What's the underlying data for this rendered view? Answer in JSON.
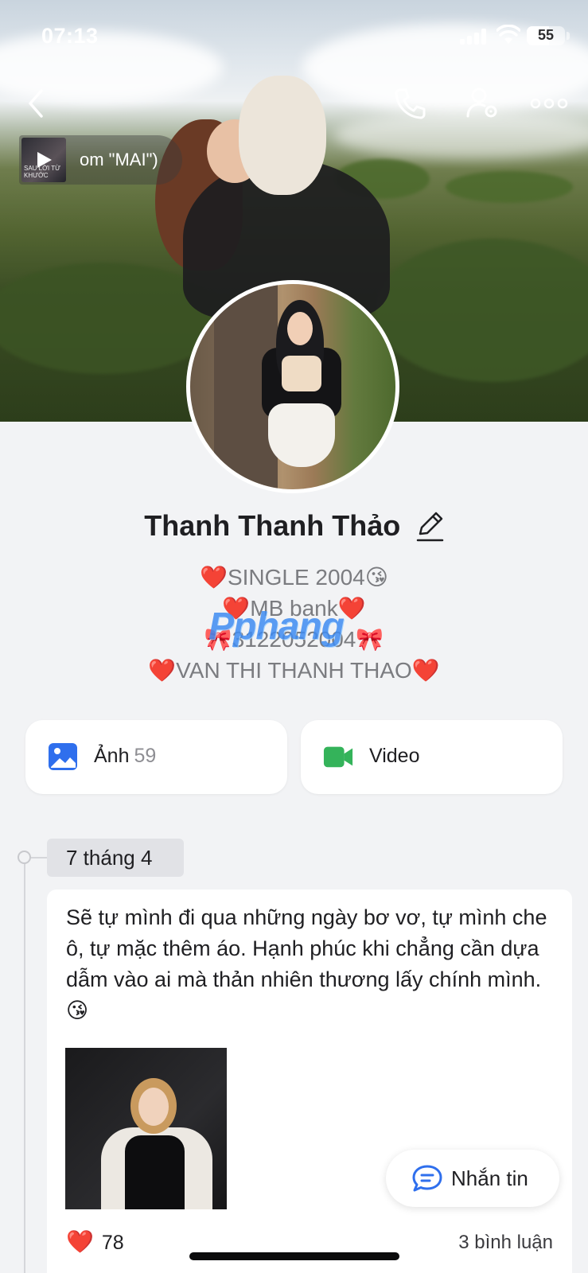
{
  "status_bar": {
    "time": "07:13",
    "battery": "55"
  },
  "nav": {
    "back_icon": "chevron-left-icon",
    "call_icon": "phone-icon",
    "settings_icon": "user-settings-icon",
    "more_icon": "more-horizontal-icon"
  },
  "music": {
    "title": "om \"MAI\")",
    "thumb_caption": "SAU LỜI TỪ KHƯỚC"
  },
  "profile": {
    "name": "Thanh Thanh Thảo",
    "bio": [
      "❤️SINGLE 2004😘",
      "❤️MB bank❤️",
      "🎀3122052004🎀",
      "❤️VAN THI THANH THAO❤️"
    ],
    "watermark": "Pphang"
  },
  "albums": [
    {
      "label": "Ảnh",
      "count": "59",
      "icon": "photo-icon",
      "color": "#2f6fed"
    },
    {
      "label": "Video",
      "count": "",
      "icon": "video-icon",
      "color": "#34b35a"
    }
  ],
  "timeline": {
    "date": "7 tháng 4",
    "post": {
      "text": "Sẽ tự mình đi qua những ngày bơ vơ, tự mình che ô, tự mặc thêm áo. Hạnh phúc khi chẳng cần dựa dẫm vào ai mà thản nhiên thương lấy chính mình.😘",
      "likes": "78",
      "comments": "3 bình luận"
    }
  },
  "message_button": {
    "label": "Nhắn tin"
  },
  "colors": {
    "accent": "#2f6fed",
    "like": "#e0242c",
    "background": "#f2f3f5"
  }
}
